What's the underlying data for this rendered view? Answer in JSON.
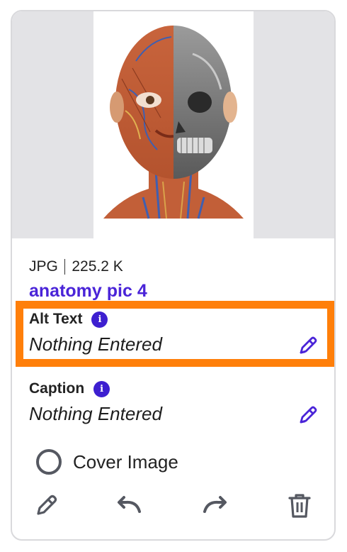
{
  "image": {
    "alt": "anatomy illustration of human head"
  },
  "file": {
    "format": "JPG",
    "size": "225.2 K",
    "title": "anatomy pic 4"
  },
  "alt_text": {
    "label": "Alt Text",
    "value": "Nothing Entered",
    "info_icon": "info-icon",
    "edit_icon": "pencil-icon"
  },
  "caption": {
    "label": "Caption",
    "value": "Nothing Entered",
    "info_icon": "info-icon",
    "edit_icon": "pencil-icon"
  },
  "cover": {
    "label": "Cover Image",
    "checked": false
  },
  "toolbar": {
    "icons": [
      "pencil-icon",
      "undo-icon",
      "redo-icon",
      "trash-icon"
    ]
  },
  "colors": {
    "accent": "#4a24d8",
    "info": "#3d1fd0",
    "highlight": "#ff7f0a",
    "icon_gray": "#555861"
  }
}
